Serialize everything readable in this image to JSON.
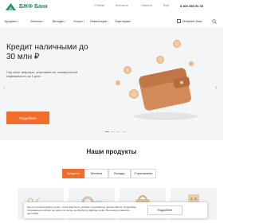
{
  "header": {
    "logo_text": "БЖФ Банк",
    "top_links": [
      "О банке",
      "Контакты",
      "Новости",
      "Ещё"
    ],
    "phone": "8 800 555 00 35"
  },
  "nav": {
    "items": [
      "Кредиты",
      "Ипотека",
      "Вклады",
      "Услуги",
      "Инвестиции",
      "Партнерам"
    ],
    "cabinet_label": "Интернет-банк"
  },
  "hero": {
    "title": "Кредит наличными до 30 млн ₽",
    "subtitle": "Под залог квартиры, апартаментов, коммерческой недвижимости за 1 день",
    "button_label": "Подробнее",
    "prev_arrow": "‹",
    "next_arrow": "›",
    "slides_count": 4,
    "active_slide": 1
  },
  "products": {
    "title": "Наши продукты",
    "tabs": [
      "Кредиты",
      "Ипотека",
      "Вклады",
      "Страхование"
    ],
    "active_tab": 0
  },
  "cookie": {
    "text": "Мы используем файлы cookie, чтобы вам было удобнее пользоваться нашим сайтом. Продолжая пользоваться сайтом, вы даёте согласие на обработку файлов cookie. Вы можете изменить настройки.",
    "button_label": "Подробнее"
  },
  "colors": {
    "brand_green": "#1f8f6e",
    "accent_orange": "#f26c2b",
    "hero_bg": "#f4f5f7",
    "card_bg": "#f2f3f5"
  }
}
